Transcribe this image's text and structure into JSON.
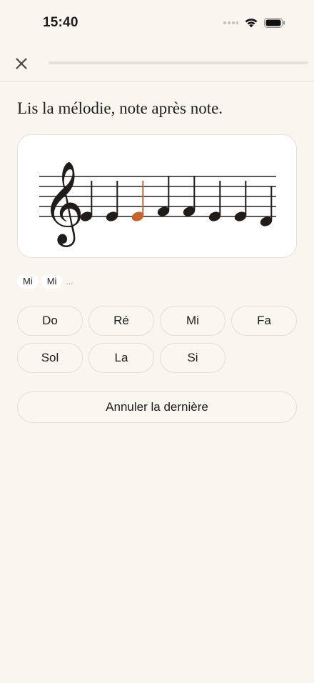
{
  "status_bar": {
    "time": "15:40",
    "icons": [
      "signal-dots-icon",
      "wifi-icon",
      "battery-icon"
    ]
  },
  "top_bar": {
    "close_icon": "close-icon",
    "progress_fraction": 0.0,
    "accent_color": "#c8622f"
  },
  "prompt": "Lis la mélodie, note après note.",
  "staff": {
    "clef": "treble-clef-icon",
    "current_note_index": 2,
    "current_color": "#c8622f",
    "note_color": "#1f1c19",
    "notes": [
      {
        "name": "Mi",
        "octave": 4
      },
      {
        "name": "Mi",
        "octave": 4
      },
      {
        "name": "Mi",
        "octave": 4
      },
      {
        "name": "Fa",
        "octave": 4
      },
      {
        "name": "Fa",
        "octave": 4
      },
      {
        "name": "Mi",
        "octave": 4
      },
      {
        "name": "Mi",
        "octave": 4
      },
      {
        "name": "Ré",
        "octave": 4
      }
    ]
  },
  "answers": {
    "entered": [
      "Mi",
      "Mi"
    ],
    "more": "..."
  },
  "note_buttons": [
    "Do",
    "Ré",
    "Mi",
    "Fa",
    "Sol",
    "La",
    "Si"
  ],
  "undo_label": "Annuler la dernière"
}
